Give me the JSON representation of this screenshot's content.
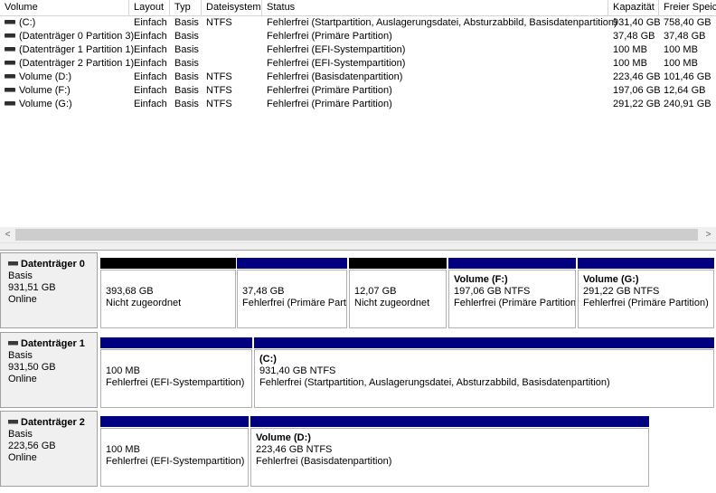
{
  "columns": [
    "Volume",
    "Layout",
    "Typ",
    "Dateisystem",
    "Status",
    "Kapazität",
    "Freier Speich"
  ],
  "volumes": [
    {
      "volume": "(C:)",
      "layout": "Einfach",
      "typ": "Basis",
      "fs": "NTFS",
      "status": "Fehlerfrei (Startpartition, Auslagerungsdatei, Absturzabbild, Basisdatenpartition)",
      "capacity": "931,40 GB",
      "free": "758,40 GB"
    },
    {
      "volume": "(Datenträger 0 Partition 3)",
      "layout": "Einfach",
      "typ": "Basis",
      "fs": "",
      "status": "Fehlerfrei (Primäre Partition)",
      "capacity": "37,48 GB",
      "free": "37,48 GB"
    },
    {
      "volume": "(Datenträger 1 Partition 1)",
      "layout": "Einfach",
      "typ": "Basis",
      "fs": "",
      "status": "Fehlerfrei (EFI-Systempartition)",
      "capacity": "100 MB",
      "free": "100 MB"
    },
    {
      "volume": "(Datenträger 2 Partition 1)",
      "layout": "Einfach",
      "typ": "Basis",
      "fs": "",
      "status": "Fehlerfrei (EFI-Systempartition)",
      "capacity": "100 MB",
      "free": "100 MB"
    },
    {
      "volume": "Volume (D:)",
      "layout": "Einfach",
      "typ": "Basis",
      "fs": "NTFS",
      "status": "Fehlerfrei (Basisdatenpartition)",
      "capacity": "223,46 GB",
      "free": "101,46 GB"
    },
    {
      "volume": "Volume (F:)",
      "layout": "Einfach",
      "typ": "Basis",
      "fs": "NTFS",
      "status": "Fehlerfrei (Primäre Partition)",
      "capacity": "197,06 GB",
      "free": "12,64 GB"
    },
    {
      "volume": "Volume (G:)",
      "layout": "Einfach",
      "typ": "Basis",
      "fs": "NTFS",
      "status": "Fehlerfrei (Primäre Partition)",
      "capacity": "291,22 GB",
      "free": "240,91 GB"
    }
  ],
  "scroll": {
    "left_arrow": "<",
    "right_arrow": ">"
  },
  "disks": [
    {
      "name": "Datenträger 0",
      "type": "Basis",
      "size": "931,51 GB",
      "state": "Online",
      "partitions": [
        {
          "bar": "black",
          "title": "",
          "size": "393,68 GB",
          "status": "Nicht zugeordnet"
        },
        {
          "bar": "blue",
          "title": "",
          "size": "37,48 GB",
          "status": "Fehlerfrei (Primäre Parti"
        },
        {
          "bar": "black",
          "title": "",
          "size": "12,07 GB",
          "status": "Nicht zugeordnet"
        },
        {
          "bar": "blue",
          "title": "Volume  (F:)",
          "size": "197,06 GB NTFS",
          "status": "Fehlerfrei (Primäre Partition"
        },
        {
          "bar": "blue",
          "title": "Volume  (G:)",
          "size": "291,22 GB NTFS",
          "status": "Fehlerfrei (Primäre Partition)"
        }
      ]
    },
    {
      "name": "Datenträger 1",
      "type": "Basis",
      "size": "931,50 GB",
      "state": "Online",
      "partitions": [
        {
          "bar": "blue",
          "title": "",
          "size": "100 MB",
          "status": "Fehlerfrei (EFI-Systempartition)"
        },
        {
          "bar": "blue",
          "title": "(C:)",
          "size": "931,40 GB NTFS",
          "status": "Fehlerfrei (Startpartition, Auslagerungsdatei, Absturzabbild, Basisdatenpartition)"
        }
      ]
    },
    {
      "name": "Datenträger 2",
      "type": "Basis",
      "size": "223,56 GB",
      "state": "Online",
      "partitions": [
        {
          "bar": "blue",
          "title": "",
          "size": "100 MB",
          "status": "Fehlerfrei (EFI-Systempartition)"
        },
        {
          "bar": "blue",
          "title": "Volume  (D:)",
          "size": "223,46 GB NTFS",
          "status": "Fehlerfrei (Basisdatenpartition)"
        }
      ]
    }
  ]
}
